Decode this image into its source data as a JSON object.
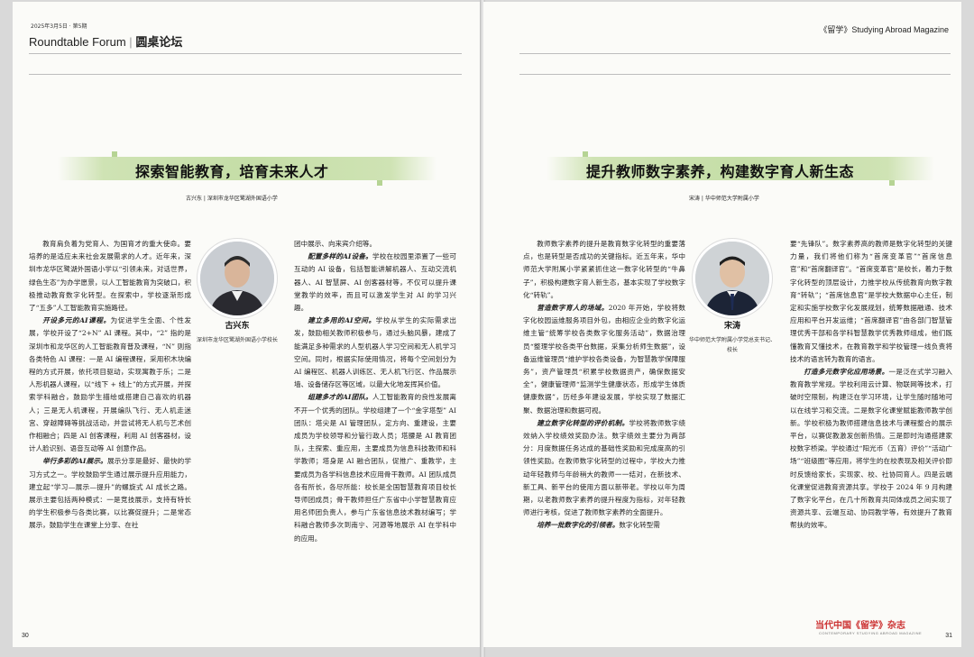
{
  "header": {
    "date_issue": "2025年3月5日 · 第5期",
    "section_en": "Roundtable Forum",
    "section_cn": "圆桌论坛",
    "magazine": "《留学》Studying Abroad Magazine"
  },
  "left": {
    "title": "探索智能教育，培育未来人才",
    "byline": "古兴东 | 深圳市龙华区鹭湖外国语小学",
    "person": {
      "name": "古兴东",
      "role": "深圳市龙华区鹭湖外国语小学校长"
    },
    "col1": [
      {
        "lead": "",
        "text": "教育肩负着为党育人、为国育才的重大使命。要培养的是适应未来社会发展需求的人才。近年来，深圳市龙华区鹭湖外国语小学以“引领未来，对话世界，绿色生态”为办学愿景，以人工智能教育为突破口，积极推动教育数字化转型。在探索中，学校逐渐形成了“五多”人工智能教育实施路径。"
      },
      {
        "lead": "开设多元的AI课程。",
        "text": "为促进学生全面、个性发展，学校开设了“2+N” AI 课程。其中，“2” 指的是深圳市和龙华区的人工智能教育普及课程，“N” 则指各类特色 AI 课程：一是 AI 编程课程，采用积木块编程的方式开展，依托项目驱动，实现寓教于乐；二是人形机器人课程，以“线下 + 线上”的方式开展，并探索学科融合，鼓励学生描绘或搭建自己喜欢的机器人；三是无人机课程，开展编队飞行、无人机走迷宫、穿越障碍等挑战活动，并尝试将无人机与艺术创作相融合；四是 AI 创客课程，利用 AI 创客器材，设计人脸识别、语音互动等 AI 创意作品。"
      },
      {
        "lead": "举行多彩的AI展示。",
        "text": "展示分享是最好、最快的学习方式之一。学校鼓励学生通过展示提升应用能力，建立起“学习—展示—提升”的螺旋式 AI 成长之路。展示主要包括两种模式：一是竞技展示，支持有特长的学生积极参与各类比赛，以比赛促提升；二是常态展示，鼓励学生在课堂上分享、在社"
      }
    ],
    "col2": [
      {
        "lead": "",
        "text": "团中展示、向来宾介绍等。",
        "noindent": true
      },
      {
        "lead": "配置多样的AI设备。",
        "text": "学校在校园里添置了一些可互动的 AI 设备，包括智能讲解机器人、互动交流机器人、AI 智慧屏、AI 创客器材等，不仅可以提升课堂教学的效率，而且可以激发学生对 AI 的学习兴趣。"
      },
      {
        "lead": "建立多用的AI空间。",
        "text": "学校从学生的实际需求出发，鼓励相关教师积极参与，通过头脑风暴，建成了能满足多种需求的人型机器人学习空间和无人机学习空间。同时，根据实际使用情况，将每个空间划分为 AI 编程区、机器人训练区、无人机飞行区、作品展示墙、设备储存区等区域，以最大化地发挥其价值。"
      },
      {
        "lead": "组建多才的AI团队。",
        "text": "人工智能教育的良性发展离不开一个优秀的团队。学校组建了一个“金字塔型” AI 团队：塔尖是 AI 管理团队，定方向、重建设，主要成员为学校领导和分管行政人员；塔腰是 AI 教育团队，主探索、重应用，主要成员为信息科技教师和科学教师；塔身是 AI 融合团队，促推广、重教学，主要成员为各学科信息技术应用骨干教师。AI 团队成员各有所长，各尽所能：校长是全国智慧教育项目校长导师团成员；骨干教师担任广东省中小学智慧教育应用名师团负责人，参与广东省信息技术教材编写；学科融合教师多次到南宁、河源等地展示 AI 在学科中的应用。"
      }
    ],
    "page_number": "30"
  },
  "right": {
    "title": "提升教师数字素养，构建数字育人新生态",
    "byline": "宋涛 | 华中师范大学附属小学",
    "person": {
      "name": "宋涛",
      "role": "华中师范大学附属小学党总支书记、校长"
    },
    "col1": [
      {
        "lead": "",
        "text": "教师数字素养的提升是教育数字化转型的重要落点，也是转型是否成功的关键指标。近五年来，华中师范大学附属小学紧紧抓住这一数字化转型的“牛鼻子”，积极构建数字育人新生态，基本实现了学校数字化“转轨”。"
      },
      {
        "lead": "营造数字育人的场域。",
        "text": "2020 年开始，学校将数字化校园运维服务项目外包，由相应企业的数字化运维主管“统筹学校各类数字化服务活动”，数据治理员“整理学校各类平台数据，采集分析师生数据”，设备运维管理员“维护学校各类设备，为智慧教学保障服务”，资产管理员“积累学校数据资产，确保数据安全”，健康管理师“监测学生健康状态，形成学生体质健康数据”，历经多年建设发展，学校实现了数据汇聚、数据治理和数据可视。"
      },
      {
        "lead": "建立数字化转型的评价机制。",
        "text": "学校将教师数字绩效纳入学校绩效奖励办法。数字绩效主要分为两部分：月度数据任务达成的基础性奖励和完成度高的引领性奖励。在教师数字化转型的过程中，学校大力推动年轻教师与年龄稍大的教师一一结对，在新技术、新工具、新平台的使用方面以新带老。学校以年为周期，以老教师数字素养的提升程度为指标，对年轻教师进行考核，促进了教师数字素养的全面提升。"
      },
      {
        "lead": "培养一批数字化的引领者。",
        "text": "数字化转型需"
      }
    ],
    "col2": [
      {
        "lead": "",
        "text": "要“先锋队”。数字素养高的教师是数字化转型的关键力量，我们将他们称为“首席变革官”“首席信息官”和“首席翻译官”。“首席变革官”是校长，着力于数字化转型的顶层设计，力推学校从传统教育向数字教育“转轨”；“首席信息官”是学校大数据中心主任，制定和实施学校数字化发展规划，统筹数据融通、技术应用和平台开发运维；“首席翻译官”由各部门智慧管理优秀干部和各学科智慧教学优秀教师组成，他们既懂教育又懂技术，在教育教学和学校管理一线负责将技术的语言转为教育的语言。",
        "noindent": true
      },
      {
        "lead": "打造多元数字化应用场景。",
        "text": "一是泛在式学习融入教育教学常规。学校利用云计算、物联网等技术，打破时空限制，构建泛在学习环境，让学生随时随地可以在线学习和交流。二是数字化课堂赋能教师教学创新。学校积极为教师搭建信息技术与课程整合的展示平台，以赛促教激发创新热情。三是即时沟通搭建家校数字桥梁。学校通过“阳光币（五育）评价”“活动广场”“班级圈”等应用，将学生的在校表现及相关评价即时反馈给家长，实现家、校、社协同育人。四是云端化课堂促进教育资源共享。学校于 2024 年 9 月构建了数字化平台，在几十所教育共同体成员之间实现了资源共享、云端互动、协同教学等，有效提升了教育帮扶的效率。"
      }
    ],
    "page_number": "31",
    "footer_logo": "当代中国《留学》杂志",
    "footer_sub": "CONTEMPORARY STUDYING ABROAD MAGAZINE"
  }
}
